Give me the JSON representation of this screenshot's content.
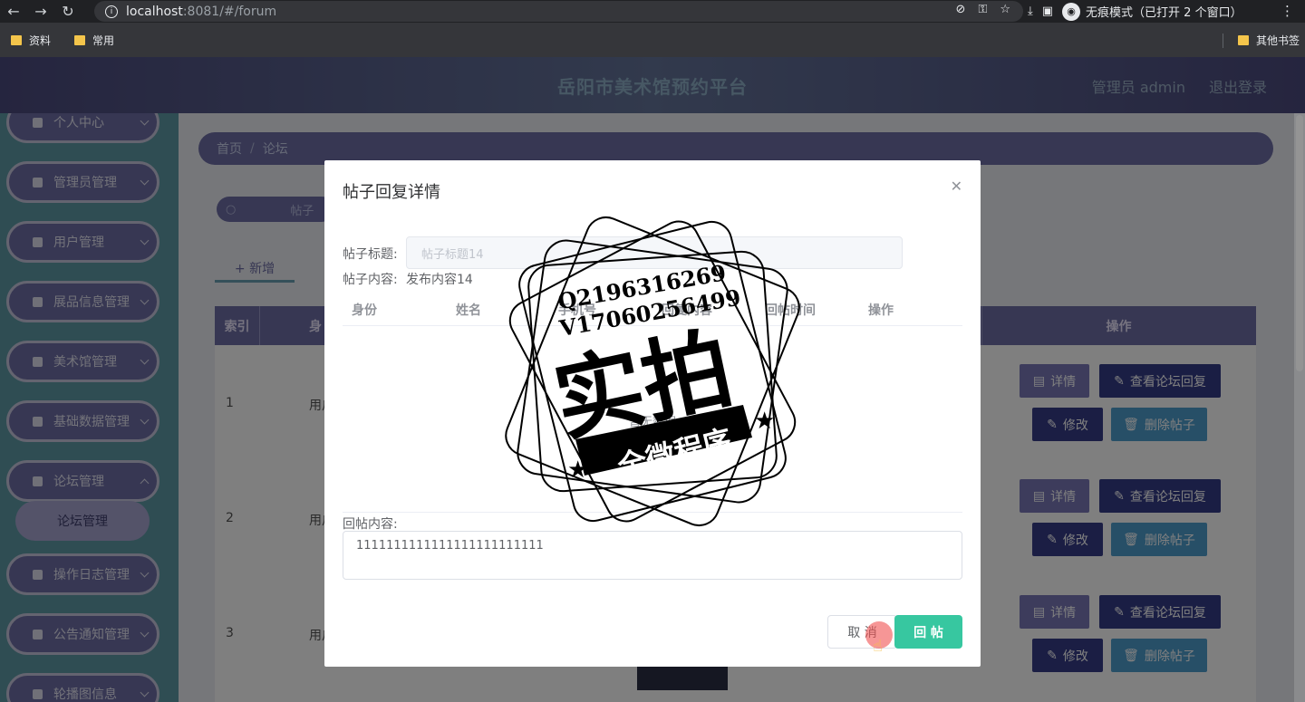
{
  "browser": {
    "url_host": "localhost",
    "url_path": ":8081/#/forum",
    "incognito_label": "无痕模式（已打开 2 个窗口）",
    "bookmarks": [
      "资料",
      "常用"
    ],
    "other_bookmarks": "其他书签"
  },
  "header": {
    "title": "岳阳市美术馆预约平台",
    "user": "管理员 admin",
    "logout": "退出登录"
  },
  "sidebar": {
    "items": [
      "个人中心",
      "管理员管理",
      "用户管理",
      "展品信息管理",
      "美术馆管理",
      "基础数据管理",
      "论坛管理",
      "操作日志管理",
      "公告通知管理",
      "轮播图信息"
    ],
    "active_sub": "论坛管理"
  },
  "breadcrumb": {
    "home": "首页",
    "current": "论坛"
  },
  "search": {
    "placeholder": "帖子"
  },
  "toolbar": {
    "add": "+ 新增"
  },
  "table": {
    "headers": {
      "index": "索引",
      "identity": "身",
      "actions": "操作"
    },
    "rows": [
      {
        "index": "1",
        "user": "用户"
      },
      {
        "index": "2",
        "user": "用户"
      },
      {
        "index": "3",
        "user": "用户"
      }
    ],
    "actions": {
      "detail": "详情",
      "reply": "查看论坛回复",
      "edit": "修改",
      "delete": "删除帖子"
    }
  },
  "modal": {
    "title": "帖子回复详情",
    "post_title_label": "帖子标题:",
    "post_title_value": "帖子标题14",
    "post_content_label": "帖子内容:",
    "post_content_value": "发布内容14",
    "columns": [
      "身份",
      "姓名",
      "手机号",
      "回复内容",
      "回帖时间",
      "操作"
    ],
    "empty_text": "暂无数据",
    "reply_label": "回帖内容:",
    "reply_value": "1111111111111111111111111",
    "cancel": "取 消",
    "submit": "回 帖"
  },
  "watermark": {
    "line1": "Q2196316269",
    "line2": "V17060256499",
    "big": "实拍",
    "ribbon": "全微程序"
  }
}
